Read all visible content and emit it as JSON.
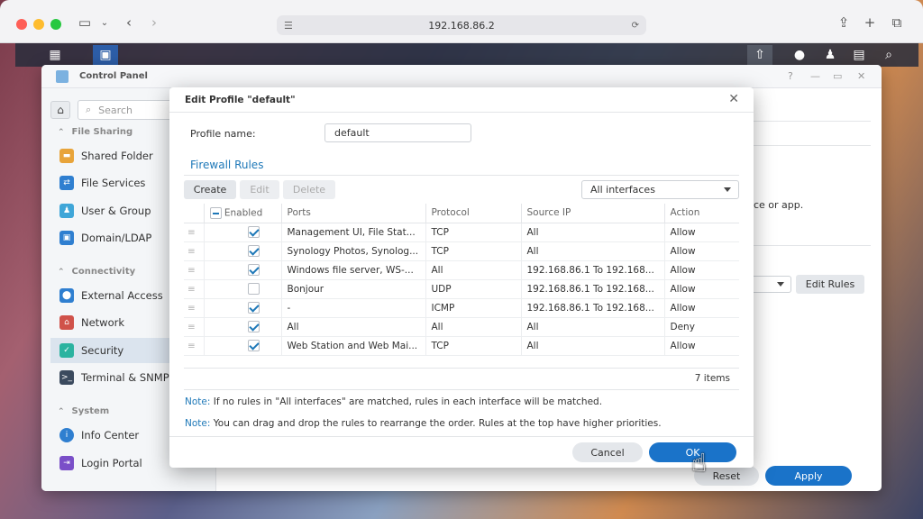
{
  "browser": {
    "url": "192.168.86.2"
  },
  "control_panel": {
    "title": "Control Panel",
    "search_placeholder": "Search",
    "sections": {
      "file_sharing": "File Sharing",
      "connectivity": "Connectivity",
      "system": "System"
    },
    "items": {
      "shared_folder": "Shared Folder",
      "file_services": "File Services",
      "user_group": "User & Group",
      "domain_ldap": "Domain/LDAP",
      "external_access": "External Access",
      "network": "Network",
      "security": "Security",
      "terminal_snmp": "Terminal & SNMP",
      "info_center": "Info Center",
      "login_portal": "Login Portal"
    },
    "main_fragment_text": "ce or app.",
    "edit_rules": "Edit Rules",
    "reset": "Reset",
    "apply": "Apply"
  },
  "dialog": {
    "title": "Edit Profile \"default\"",
    "profile_name_label": "Profile name:",
    "profile_name_value": "default",
    "section_title": "Firewall Rules",
    "toolbar": {
      "create": "Create",
      "edit": "Edit",
      "delete": "Delete"
    },
    "interface_select": "All interfaces",
    "columns": {
      "enabled": "Enabled",
      "ports": "Ports",
      "protocol": "Protocol",
      "source_ip": "Source IP",
      "action": "Action"
    },
    "rows": [
      {
        "enabled": true,
        "ports": "Management UI, File Stat...",
        "protocol": "TCP",
        "source_ip": "All",
        "action": "Allow"
      },
      {
        "enabled": true,
        "ports": "Synology Photos, Synolog...",
        "protocol": "TCP",
        "source_ip": "All",
        "action": "Allow"
      },
      {
        "enabled": true,
        "ports": "Windows file server, WS-...",
        "protocol": "All",
        "source_ip": "192.168.86.1 To 192.168...",
        "action": "Allow"
      },
      {
        "enabled": false,
        "ports": "Bonjour",
        "protocol": "UDP",
        "source_ip": "192.168.86.1 To 192.168...",
        "action": "Allow"
      },
      {
        "enabled": true,
        "ports": "-",
        "protocol": "ICMP",
        "source_ip": "192.168.86.1 To 192.168...",
        "action": "Allow"
      },
      {
        "enabled": true,
        "ports": "All",
        "protocol": "All",
        "source_ip": "All",
        "action": "Deny"
      },
      {
        "enabled": true,
        "ports": "Web Station and Web Mai...",
        "protocol": "TCP",
        "source_ip": "All",
        "action": "Allow"
      }
    ],
    "item_count": "7 items",
    "note_label": "Note:",
    "note1": "If no rules in \"All interfaces\" are matched, rules in each interface will be matched.",
    "note2": "You can drag and drop the rules to rearrange the order. Rules at the top have higher priorities.",
    "cancel": "Cancel",
    "ok": "OK"
  },
  "colors": {
    "accent": "#1e78b8",
    "ok_button": "#1a73c9",
    "security_selected_bg": "#dbe4ee"
  }
}
